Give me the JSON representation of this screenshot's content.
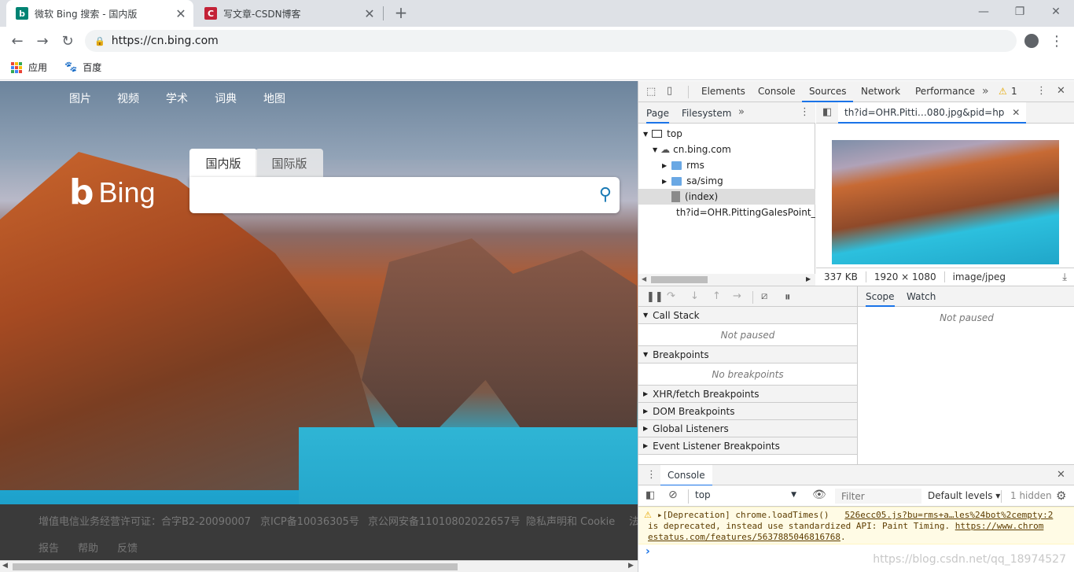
{
  "tabs": [
    {
      "title": "微软 Bing 搜索 - 国内版",
      "active": true,
      "favicon": "bing-icon",
      "color": "#008373"
    },
    {
      "title": "写文章-CSDN博客",
      "active": false,
      "favicon": "csdn-icon",
      "color": "#c32136"
    }
  ],
  "toolbar": {
    "url": "https://cn.bing.com"
  },
  "bookmarks": [
    {
      "label": "应用",
      "icon": "apps-icon"
    },
    {
      "label": "百度",
      "icon": "baidu-paw-icon"
    }
  ],
  "page": {
    "nav": [
      "图片",
      "视频",
      "学术",
      "词典",
      "地图"
    ],
    "logo": "Bing",
    "search_tabs": [
      "国内版",
      "国际版"
    ],
    "footer_row1": [
      "增值电信业务经营许可证：合字B2-20090007",
      "京ICP备10036305号",
      "京公网安备11010802022657号",
      "隐私声明和 Cookie",
      "法"
    ],
    "footer_row2": [
      "报告",
      "帮助",
      "反馈"
    ],
    "scroll_fraction": 0.72
  },
  "devtools": {
    "tabs": [
      "Elements",
      "Console",
      "Sources",
      "Network",
      "Performance"
    ],
    "selected_tab": "Sources",
    "warning_count": "1",
    "navigator_tabs": [
      "Page",
      "Filesystem"
    ],
    "tree": [
      {
        "label": "top",
        "type": "frame"
      },
      {
        "label": "cn.bing.com",
        "type": "cloud"
      },
      {
        "label": "rms",
        "type": "folder"
      },
      {
        "label": "sa/simg",
        "type": "folder"
      },
      {
        "label": "(index)",
        "type": "file"
      },
      {
        "label": "th?id=OHR.PittingGalesPoint_Z",
        "type": "image"
      }
    ],
    "open_file": "th?id=OHR.Pitti…080.jpg&pid=hp",
    "image_size": "337 KB",
    "image_dims": "1920 × 1080",
    "image_type": "image/jpeg",
    "sections": [
      {
        "label": "Call Stack",
        "body": "Not paused"
      },
      {
        "label": "Breakpoints",
        "body": "No breakpoints"
      },
      {
        "label": "XHR/fetch Breakpoints"
      },
      {
        "label": "DOM Breakpoints"
      },
      {
        "label": "Global Listeners"
      },
      {
        "label": "Event Listener Breakpoints"
      }
    ],
    "scope_tabs": [
      "Scope",
      "Watch"
    ],
    "scope_body": "Not paused",
    "drawer_tab": "Console",
    "context": "top",
    "filter_placeholder": "Filter",
    "levels": "Default levels ▾",
    "hidden": "1 hidden",
    "warning_line1": "▸[Deprecation] chrome.loadTimes()",
    "warning_link1": "526ecc05.js?bu=rms+a…les%24bot%2cempty:2",
    "warning_line2": "is deprecated, instead use standardized API: Paint Timing.",
    "warning_link2": "https://www.chrom",
    "warning_line3": "estatus.com/features/5637885046816768",
    "warning_tail": ".",
    "prompt": "›"
  },
  "watermark": "https://blog.csdn.net/qq_18974527"
}
